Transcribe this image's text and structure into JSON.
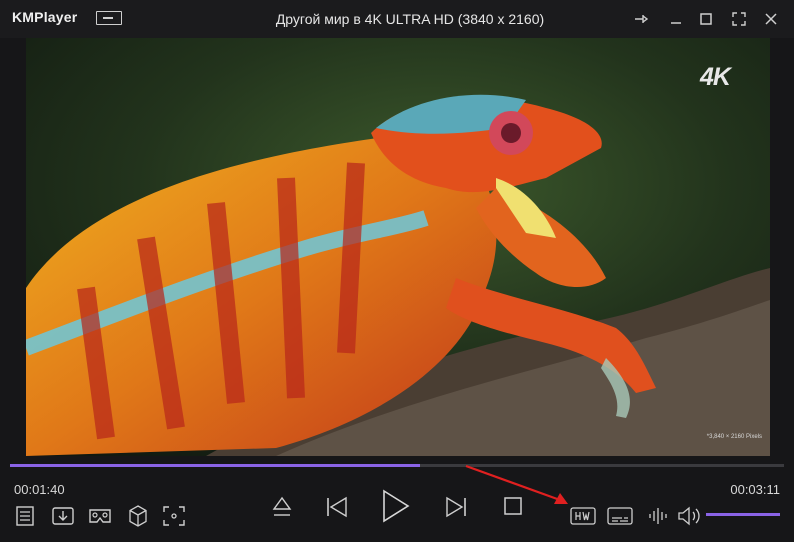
{
  "app": {
    "name": "KMPlayer"
  },
  "window": {
    "title": "Другой мир в 4K ULTRA HD (3840 x 2160)"
  },
  "video": {
    "badge": "4K",
    "pixel_note": "*3,840 × 2160 Pixels"
  },
  "playback": {
    "current_time": "00:01:40",
    "total_time": "00:03:11",
    "progress_fraction": 0.53
  },
  "volume": {
    "level_fraction": 1.0
  },
  "colors": {
    "accent": "#8a63e6",
    "annotation_arrow": "#e02020"
  },
  "icons": {
    "titlebar": [
      "pin-icon",
      "minimize-icon",
      "maximize-icon",
      "fullscreen-icon",
      "close-icon"
    ],
    "left_controls": [
      "playlist-icon",
      "download-icon",
      "vr-icon",
      "3d-icon",
      "capture-icon"
    ],
    "center_controls": [
      "eject-icon",
      "previous-icon",
      "play-icon",
      "next-icon",
      "stop-icon"
    ],
    "right_controls": [
      "hw-decoder-icon",
      "subtitle-icon",
      "audio-wave-icon",
      "volume-icon"
    ]
  }
}
